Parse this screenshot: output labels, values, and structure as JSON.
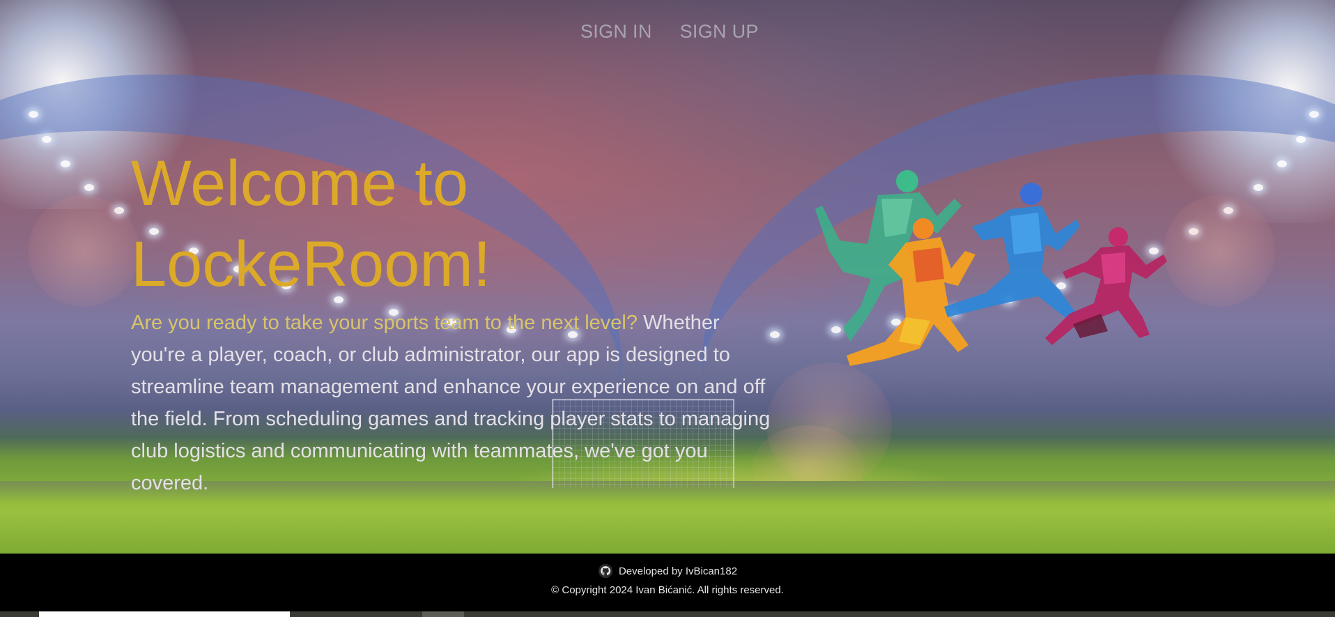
{
  "nav": {
    "sign_in": "SIGN IN",
    "sign_up": "SIGN UP"
  },
  "hero": {
    "headline_line1": "Welcome to",
    "headline_line2": "LockeRoom!",
    "question": "Are you ready to take your sports team to the next level?",
    "body": "Whether you're a player, coach, or club administrator, our app is designed to streamline team management and enhance your experience on and off the field. From scheduling games and tracking player stats to managing club logistics and communicating with teammates, we've got you covered."
  },
  "footer": {
    "developed_by": "Developed by IvBican182",
    "copyright": "© Copyright 2024 Ivan Bićanić. All rights reserved."
  },
  "colors": {
    "headline": "#dcaa28",
    "question": "#d8c46a",
    "body_text": "#e4e0e6",
    "nav_text": "#a9a3b2",
    "footer_bg": "#000000"
  },
  "icons": {
    "github": "github-icon"
  }
}
